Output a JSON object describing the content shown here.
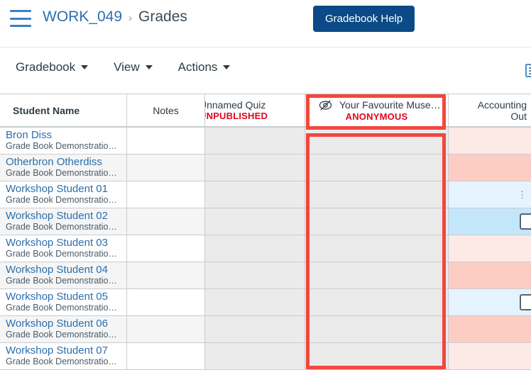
{
  "header": {
    "menu_icon": "hamburger-menu-icon",
    "course": "WORK_049",
    "separator": "›",
    "page": "Grades",
    "help_button": "Gradebook Help"
  },
  "toolbar": {
    "menus": [
      {
        "label": "Gradebook"
      },
      {
        "label": "View"
      },
      {
        "label": "Actions"
      }
    ],
    "right_icon": "grid-settings-icon"
  },
  "grid": {
    "columns": {
      "student_name": "Student Name",
      "notes": "Notes",
      "quiz_title": "Unnamed Quiz",
      "quiz_status": "UNPUBLISHED",
      "anon_icon": "eye-slash-icon",
      "anon_title": "Your Favourite Muse…",
      "anon_status": "ANONYMOUS",
      "acct_line1": "Accounting",
      "acct_line2": "Out"
    },
    "section_label": "Grade Book Demonstratio…",
    "rows": [
      {
        "name": "Bron Diss",
        "section": "Grade Book Demonstratio…",
        "acct_color": "#fdeae6",
        "acct_widget": "none"
      },
      {
        "name": "Otherbron Otherdiss",
        "section": "Grade Book Demonstratio…",
        "acct_color": "#fdcdc4",
        "acct_widget": "none"
      },
      {
        "name": "Workshop Student 01",
        "section": "Grade Book Demonstratio…",
        "acct_color": "#e4f3fd",
        "acct_widget": "dots"
      },
      {
        "name": "Workshop Student 02",
        "section": "Grade Book Demonstratio…",
        "acct_color": "#c3e6fa",
        "acct_widget": "box"
      },
      {
        "name": "Workshop Student 03",
        "section": "Grade Book Demonstratio…",
        "acct_color": "#fdeae6",
        "acct_widget": "none"
      },
      {
        "name": "Workshop Student 04",
        "section": "Grade Book Demonstratio…",
        "acct_color": "#fdcdc4",
        "acct_widget": "none"
      },
      {
        "name": "Workshop Student 05",
        "section": "Grade Book Demonstratio…",
        "acct_color": "#e4f3fd",
        "acct_widget": "box"
      },
      {
        "name": "Workshop Student 06",
        "section": "Grade Book Demonstratio…",
        "acct_color": "#fdcdc4",
        "acct_widget": "none"
      },
      {
        "name": "Workshop Student 07",
        "section": "Grade Book Demonstratio…",
        "acct_color": "#fdeae6",
        "acct_widget": "none"
      }
    ]
  },
  "annotations": {
    "highlight_color": "#f4463c",
    "highlight_header_label": "anonymous-column-header-highlight",
    "highlight_body_label": "anonymous-column-body-highlight"
  }
}
